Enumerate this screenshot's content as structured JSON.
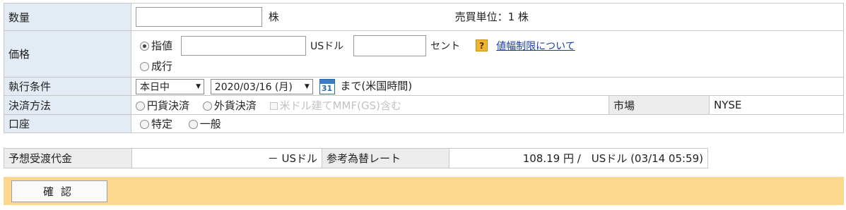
{
  "quantity": {
    "label": "数量",
    "value": "",
    "unit": "株",
    "trade_unit_label": "売買単位：1 株"
  },
  "price": {
    "label": "価格",
    "limit_label": "指値",
    "market_label": "成行",
    "dollar_value": "",
    "dollar_unit": "USドル",
    "cent_value": "",
    "cent_unit": "セント",
    "help_icon": "?",
    "price_limit_link": "値幅制限について",
    "selected": "limit"
  },
  "execution": {
    "label": "執行条件",
    "condition": "本日中",
    "date": "2020/03/16 (月)",
    "calendar_day": "31",
    "until_text": "まで(米国時間)"
  },
  "settlement": {
    "label": "決済方法",
    "yen_label": "円貨決済",
    "foreign_label": "外貨決済",
    "mmf_label": "米ドル建てMMF(GS)含む",
    "market_label": "市場",
    "market_value": "NYSE"
  },
  "account": {
    "label": "口座",
    "specific_label": "特定",
    "general_label": "一般"
  },
  "estimate": {
    "label": "予想受渡代金",
    "value": "－ USドル",
    "rate_label": "参考為替レート",
    "rate_value": "108.19 円 /　USドル (03/14 05:59)"
  },
  "confirm": {
    "label": "確認"
  },
  "colors": {
    "label_bg": "#e3ebf4",
    "confirm_bar_bg": "#fcd88e",
    "link": "#1a3aa8",
    "help_icon": "#f2b330"
  }
}
